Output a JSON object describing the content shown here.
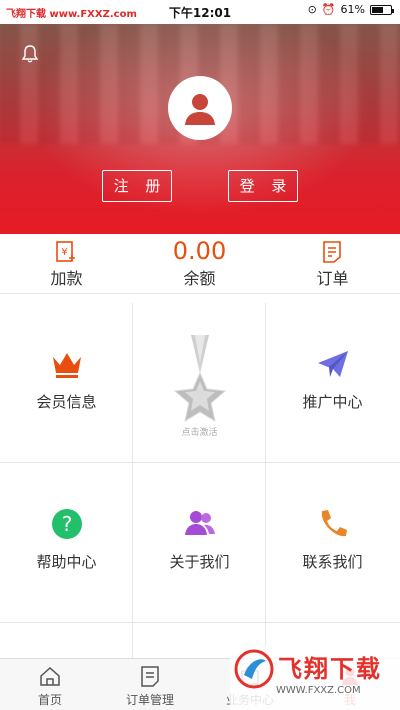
{
  "status_bar": {
    "carrier": "飞翔下载 www.FXXZ.com",
    "time": "下午12:01",
    "battery": "61%",
    "battery_level": 0.61
  },
  "header": {
    "register_label": "注 册",
    "login_label": "登 录",
    "bell_icon": "bell-icon",
    "avatar_icon": "user-avatar-icon"
  },
  "summary": {
    "add_funds_label": "加款",
    "balance_value": "0.00",
    "balance_label": "余额",
    "orders_label": "订单"
  },
  "grid": {
    "member_info": "会员信息",
    "medal_caption": "点击激活",
    "promotion_center": "推广中心",
    "help_center": "帮助中心",
    "about_us": "关于我们",
    "contact_us": "联系我们"
  },
  "tabbar": {
    "home": "首页",
    "order_management": "订单管理",
    "business_center": "业务中心",
    "me": "我"
  },
  "watermark": {
    "brand": "飞翔下载",
    "site": "WWW.FXXZ.COM"
  },
  "colors": {
    "accent": "#e61b25",
    "orange": "#e84e0f",
    "green": "#22c06a",
    "purple": "#a64bd6",
    "blue": "#6e6fe0"
  }
}
